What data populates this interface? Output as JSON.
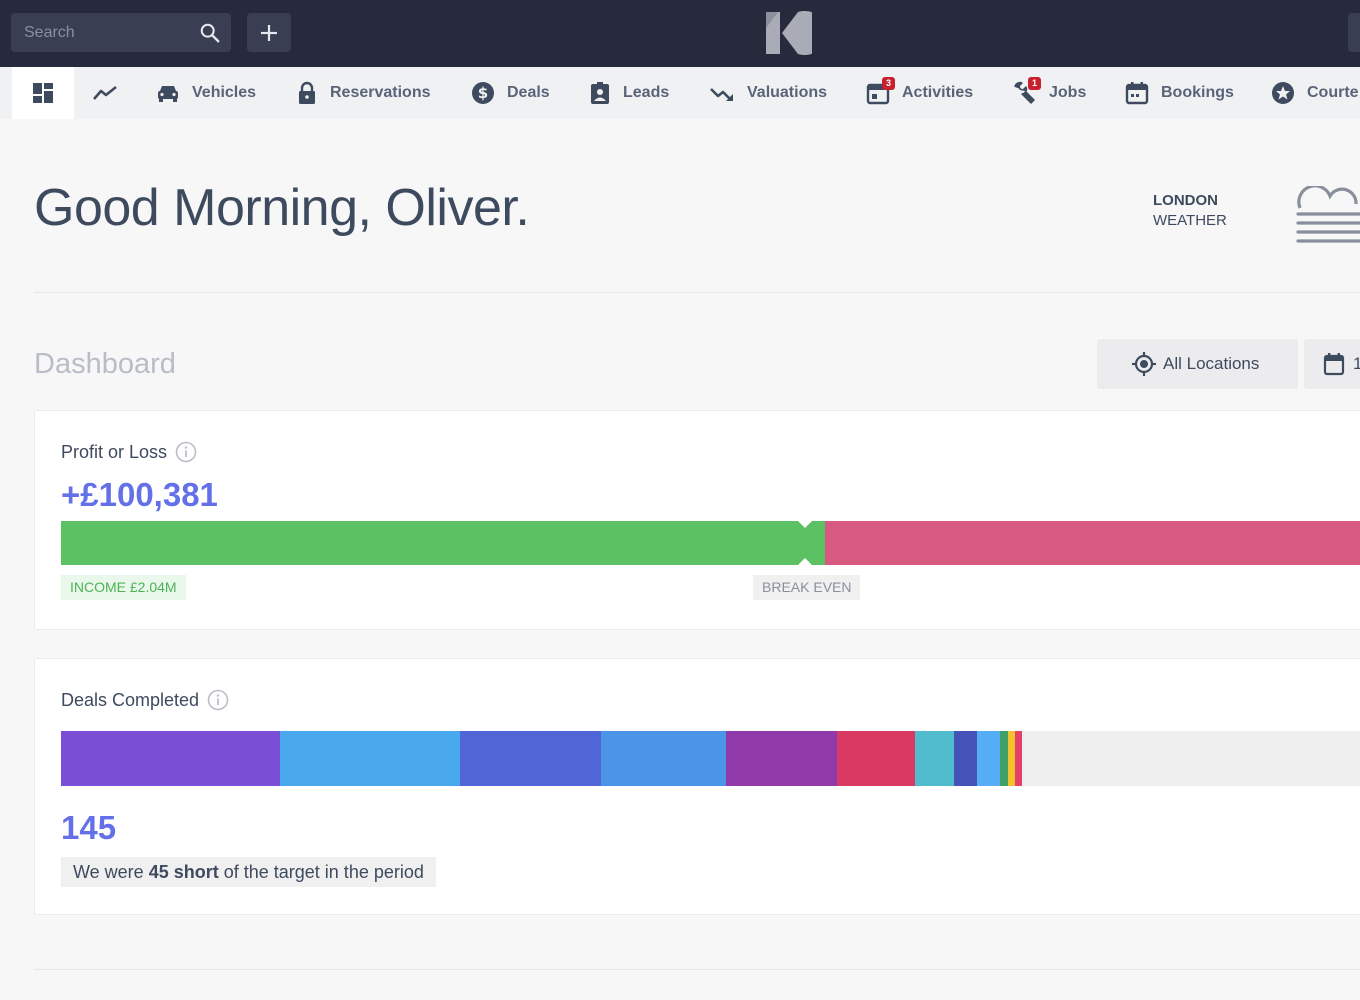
{
  "topbar": {
    "search_placeholder": "Search",
    "logo_icon": "k-logo-icon",
    "add_icon": "plus-icon"
  },
  "nav": {
    "items": [
      {
        "label": "",
        "icon": "dashboard-grid-icon",
        "active": true
      },
      {
        "label": "",
        "icon": "trend-line-icon"
      },
      {
        "label": "Vehicles",
        "icon": "car-icon"
      },
      {
        "label": "Reservations",
        "icon": "lock-icon"
      },
      {
        "label": "Deals",
        "icon": "dollar-circle-icon"
      },
      {
        "label": "Leads",
        "icon": "contact-card-icon"
      },
      {
        "label": "Valuations",
        "icon": "trend-down-icon"
      },
      {
        "label": "Activities",
        "icon": "calendar-icon",
        "badge": "3"
      },
      {
        "label": "Jobs",
        "icon": "wrench-icon",
        "badge": "1"
      },
      {
        "label": "Bookings",
        "icon": "calendar-icon"
      },
      {
        "label": "Courte",
        "icon": "star-circle-icon"
      }
    ]
  },
  "greeting": "Good Morning, Oliver.",
  "weather": {
    "city": "LONDON",
    "label": "WEATHER",
    "icon": "fog-cloud-icon"
  },
  "dashboard": {
    "title": "Dashboard",
    "location_filter": "All Locations",
    "date_filter": "1"
  },
  "profit_loss": {
    "title": "Profit or Loss",
    "value": "+£100,381",
    "income_share": 0.5785,
    "income_label": "INCOME £2.04M",
    "break_even_label": "BREAK EVEN",
    "colors": {
      "income": "#5cc163",
      "expense": "#d95a80"
    }
  },
  "deals_completed": {
    "title": "Deals Completed",
    "value": "145",
    "note_prefix": "We were ",
    "note_bold": "45 short",
    "note_suffix": " of the target in the period",
    "segments": [
      {
        "share": 0.1659,
        "color": "#7a4fd6"
      },
      {
        "share": 0.1364,
        "color": "#49a8ec"
      },
      {
        "share": 0.1068,
        "color": "#5065d6"
      },
      {
        "share": 0.0947,
        "color": "#4a95e8"
      },
      {
        "share": 0.0841,
        "color": "#8f3aa8"
      },
      {
        "share": 0.0591,
        "color": "#d83a63"
      },
      {
        "share": 0.0295,
        "color": "#52bccf"
      },
      {
        "share": 0.0174,
        "color": "#4552b8"
      },
      {
        "share": 0.0174,
        "color": "#55aef5"
      },
      {
        "share": 0.0061,
        "color": "#3fa068"
      },
      {
        "share": 0.0053,
        "color": "#f2c230"
      },
      {
        "share": 0.0053,
        "color": "#e53f6a"
      }
    ],
    "colors": {
      "remaining": "#efefef"
    }
  }
}
